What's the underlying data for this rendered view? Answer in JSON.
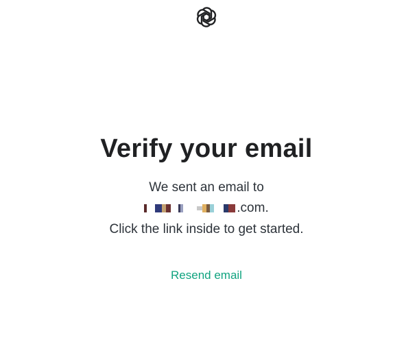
{
  "logo": {
    "icon": "openai-logo-icon"
  },
  "heading": "Verify your email",
  "message": {
    "line1": "We sent an email to",
    "email_domain_suffix": ".com.",
    "line3": "Click the link inside to get started."
  },
  "resend_label": "Resend email",
  "colors": {
    "heading": "#202123",
    "text": "#2d333a",
    "link": "#10a37f",
    "background": "#ffffff"
  }
}
